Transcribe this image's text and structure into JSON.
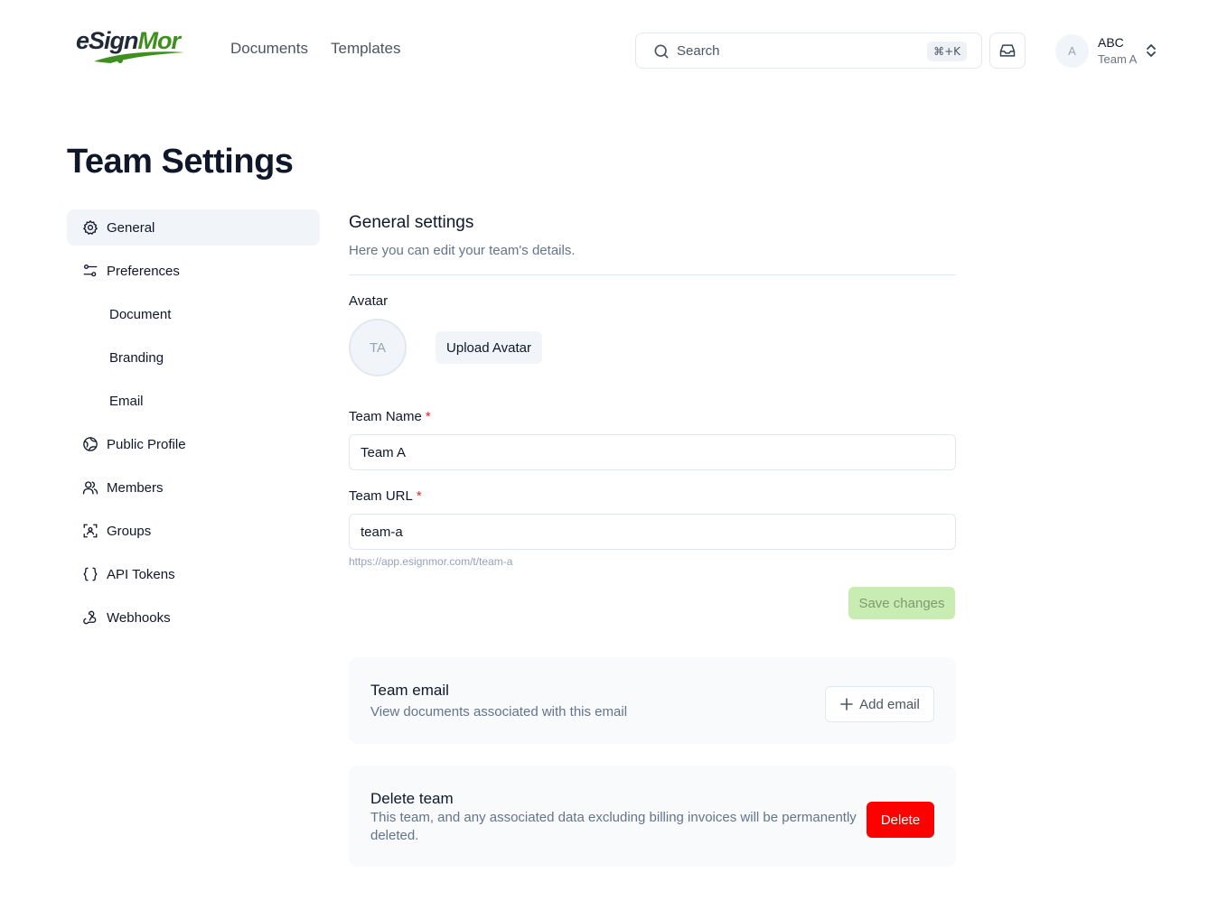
{
  "header": {
    "logo": {
      "part1": "e",
      "part2": "Sign",
      "part3": "Mor"
    },
    "nav": [
      {
        "label": "Documents"
      },
      {
        "label": "Templates"
      }
    ],
    "search": {
      "label": "Search",
      "shortcut": "⌘+K"
    },
    "user": {
      "initial": "A",
      "name": "ABC",
      "team": "Team A"
    }
  },
  "page": {
    "title": "Team Settings"
  },
  "sidebar": {
    "items": [
      {
        "label": "General",
        "icon": "gear-icon",
        "active": true
      },
      {
        "label": "Preferences",
        "icon": "sliders-icon"
      },
      {
        "label": "Document",
        "sub": true
      },
      {
        "label": "Branding",
        "sub": true
      },
      {
        "label": "Email",
        "sub": true
      },
      {
        "label": "Public Profile",
        "icon": "globe-icon"
      },
      {
        "label": "Members",
        "icon": "users-icon"
      },
      {
        "label": "Groups",
        "icon": "group-icon"
      },
      {
        "label": "API Tokens",
        "icon": "braces-icon"
      },
      {
        "label": "Webhooks",
        "icon": "webhook-icon"
      }
    ]
  },
  "general": {
    "title": "General settings",
    "description": "Here you can edit your team's details.",
    "avatar_label": "Avatar",
    "avatar_initials": "TA",
    "upload_label": "Upload Avatar",
    "team_name_label": "Team Name",
    "team_name_value": "Team A",
    "team_url_label": "Team URL",
    "team_url_value": "team-a",
    "team_url_hint": "https://app.esignmor.com/t/team-a",
    "required_mark": "*",
    "save_label": "Save changes"
  },
  "team_email": {
    "title": "Team email",
    "description": "View documents associated with this email",
    "button_label": "Add email"
  },
  "delete_team": {
    "title": "Delete team",
    "description": "This team, and any associated data excluding billing invoices will be permanently deleted.",
    "button_label": "Delete"
  },
  "colors": {
    "brand_green": "#3f8f1f",
    "save_disabled_bg": "#c8ecb1",
    "delete_red": "#ff0000",
    "active_bg": "#f1f5f9"
  }
}
